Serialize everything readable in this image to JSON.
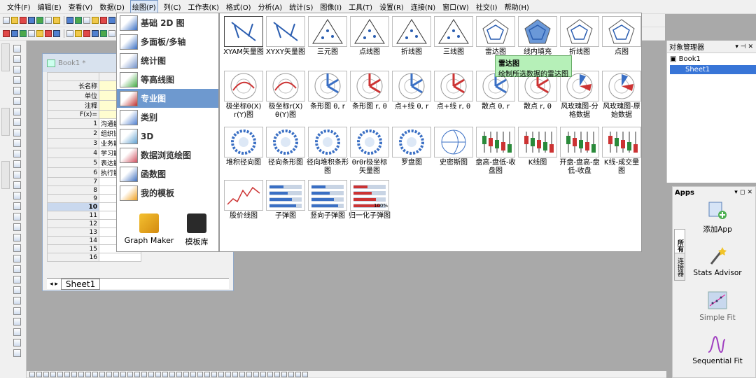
{
  "menubar": {
    "items": [
      "文件(F)",
      "编辑(E)",
      "查看(V)",
      "数据(D)",
      "绘图(P)",
      "列(C)",
      "工作表(K)",
      "格式(O)",
      "分析(A)",
      "统计(S)",
      "图像(I)",
      "工具(T)",
      "设置(R)",
      "连接(N)",
      "窗口(W)",
      "社交(I)",
      "帮助(H)"
    ],
    "active_index": 4
  },
  "book": {
    "title": "Book1 *",
    "col_a": "A",
    "row_headers": [
      "长名称",
      "单位",
      "注释",
      "F(x)="
    ],
    "rows": [
      "1",
      "2",
      "3",
      "4",
      "5",
      "6",
      "7",
      "8",
      "9",
      "10",
      "11",
      "12",
      "13",
      "14",
      "15",
      "16"
    ],
    "selected_row": "10",
    "cells": [
      "沟通能",
      "组织协",
      "业务能",
      "学习能",
      "表达能",
      "执行能"
    ],
    "sheet_tab": "Sheet1"
  },
  "plot_menu": {
    "items": [
      "基础 2D 图",
      "多面板/多轴",
      "统计图",
      "等高线图",
      "专业图",
      "类别",
      "3D",
      "数据浏览绘图",
      "函数图",
      "我的模板"
    ],
    "selected": "专业图",
    "graph_maker": "Graph Maker",
    "template_lib": "模板库"
  },
  "gallery": {
    "row1": [
      "XYAM矢量图",
      "XYXY矢量图",
      "三元图",
      "点线图",
      "折线图",
      "三线图",
      "雷达图",
      "线内填充",
      "折线图",
      "点图"
    ],
    "row2": [
      "极坐标θ(X) r(Y)图",
      "极坐标r(X) θ(Y)图",
      "条形图 θ, r",
      "条形图 r, θ",
      "点+线 θ, r",
      "点+线 r, θ",
      "散点 θ, r",
      "散点 r, θ",
      "风玫瑰图-分格数据",
      "风玫瑰图-原始数据"
    ],
    "row3": [
      "堆积径向图",
      "径向条形图",
      "径向堆积条形图",
      "θrθr极坐标矢量图",
      "罗盘图",
      "史密斯图",
      "盘高-盘低-收盘图",
      "K线图",
      "开盘-盘高-盘低-收盘",
      "K线-成交量图"
    ],
    "row4": [
      "股价线图",
      "子弹图",
      "竖向子弹图",
      "归一化子弹图"
    ],
    "tooltip_title": "雷达图",
    "tooltip_desc": "绘制所选数据的雷达图",
    "pct_label": "100%"
  },
  "object_manager": {
    "title": "对象管理器",
    "book": "Book1",
    "sheet": "Sheet1"
  },
  "apps": {
    "title": "Apps",
    "tab_all": "所有",
    "tab_conn": "连接器",
    "items": [
      "添加App",
      "Stats Advisor",
      "Simple Fit",
      "Sequential Fit"
    ]
  },
  "colors": {
    "accent": "#6e99cf",
    "tooltip": "#b6f0b8",
    "selected_sheet": "#3875d7"
  }
}
